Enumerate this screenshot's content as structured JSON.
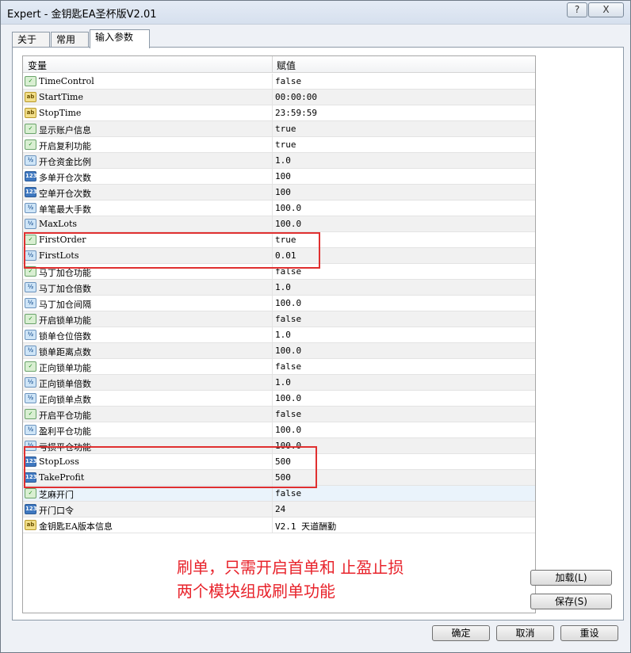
{
  "window": {
    "title": "Expert - 金钥匙EA圣杯版V2.01",
    "help_label": "?",
    "close_label": "X"
  },
  "tabs": [
    {
      "label": "关于"
    },
    {
      "label": "常用"
    },
    {
      "label": "输入参数"
    }
  ],
  "grid": {
    "headers": {
      "variable": "变量",
      "value": "赋值"
    },
    "rows": [
      {
        "type": "bool",
        "icon": "bool-icon",
        "name": "TimeControl",
        "value": "false"
      },
      {
        "type": "str",
        "icon": "string-icon",
        "name": "StartTime",
        "value": "00:00:00"
      },
      {
        "type": "str",
        "icon": "string-icon",
        "name": "StopTime",
        "value": "23:59:59"
      },
      {
        "type": "bool",
        "icon": "bool-icon",
        "name": "显示账户信息",
        "value": "true"
      },
      {
        "type": "bool",
        "icon": "bool-icon",
        "name": "开启复利功能",
        "value": "true"
      },
      {
        "type": "dbl",
        "icon": "double-icon",
        "name": "开仓资金比例",
        "value": "1.0"
      },
      {
        "type": "int",
        "icon": "integer-icon",
        "name": "多单开仓次数",
        "value": "100"
      },
      {
        "type": "int",
        "icon": "integer-icon",
        "name": "空单开仓次数",
        "value": "100"
      },
      {
        "type": "dbl",
        "icon": "double-icon",
        "name": "单笔最大手数",
        "value": "100.0"
      },
      {
        "type": "dbl",
        "icon": "double-icon",
        "name": "MaxLots",
        "value": "100.0"
      },
      {
        "type": "bool",
        "icon": "bool-icon",
        "name": "FirstOrder",
        "value": "true"
      },
      {
        "type": "dbl",
        "icon": "double-icon",
        "name": "FirstLots",
        "value": "0.01"
      },
      {
        "type": "bool",
        "icon": "bool-icon",
        "name": "马丁加仓功能",
        "value": "false"
      },
      {
        "type": "dbl",
        "icon": "double-icon",
        "name": "马丁加仓倍数",
        "value": "1.0"
      },
      {
        "type": "dbl",
        "icon": "double-icon",
        "name": "马丁加仓间隔",
        "value": "100.0"
      },
      {
        "type": "bool",
        "icon": "bool-icon",
        "name": "开启锁单功能",
        "value": "false"
      },
      {
        "type": "dbl",
        "icon": "double-icon",
        "name": "锁单仓位倍数",
        "value": "1.0"
      },
      {
        "type": "dbl",
        "icon": "double-icon",
        "name": "锁单距离点数",
        "value": "100.0"
      },
      {
        "type": "bool",
        "icon": "bool-icon",
        "name": "正向锁单功能",
        "value": "false"
      },
      {
        "type": "dbl",
        "icon": "double-icon",
        "name": "正向锁单倍数",
        "value": "1.0"
      },
      {
        "type": "dbl",
        "icon": "double-icon",
        "name": "正向锁单点数",
        "value": "100.0"
      },
      {
        "type": "bool",
        "icon": "bool-icon",
        "name": "开启平仓功能",
        "value": "false"
      },
      {
        "type": "dbl",
        "icon": "double-icon",
        "name": "盈利平仓功能",
        "value": "100.0"
      },
      {
        "type": "dbl",
        "icon": "double-icon",
        "name": "亏损平仓功能",
        "value": "100.0"
      },
      {
        "type": "int",
        "icon": "integer-icon",
        "name": "StopLoss",
        "value": "500"
      },
      {
        "type": "int",
        "icon": "integer-icon",
        "name": "TakeProfit",
        "value": "500"
      },
      {
        "type": "bool",
        "icon": "bool-icon",
        "name": "芝麻开门",
        "value": "false"
      },
      {
        "type": "int",
        "icon": "integer-icon",
        "name": "开门口令",
        "value": "24"
      },
      {
        "type": "str",
        "icon": "string-icon",
        "name": "金钥匙EA版本信息",
        "value": "V2.1 天道酬勤"
      }
    ]
  },
  "icon_text": {
    "bool": "✓",
    "str": "ab",
    "dbl": "½",
    "int": "123"
  },
  "annotation": {
    "line1": "刷单，只需开启首单和 止盈止损",
    "line2": "两个模块组成刷单功能"
  },
  "side_buttons": {
    "load": "加载(L)",
    "save": "保存(S)"
  },
  "bottom_buttons": {
    "ok": "确定",
    "cancel": "取消",
    "reset": "重设"
  },
  "colors": {
    "highlight_box": "#e03030",
    "annotation_text": "#e8232b"
  }
}
